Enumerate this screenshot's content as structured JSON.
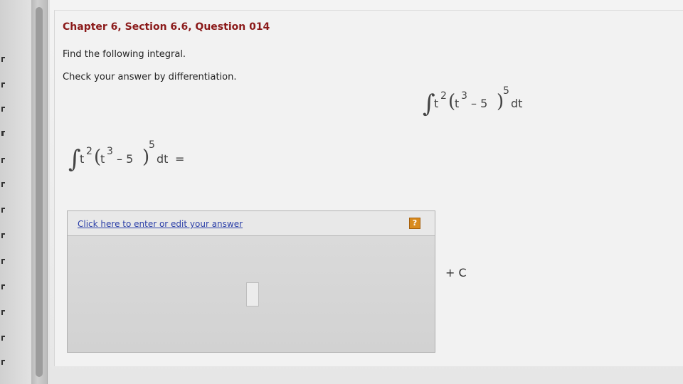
{
  "question": {
    "title": "Chapter 6, Section 6.6, Question 014",
    "instruction_1": "Find the following integral.",
    "instruction_2": "Check your answer by differentiation."
  },
  "integral": {
    "sign": "∫",
    "base": "t",
    "outer_exponent": "2",
    "open_paren": "(",
    "inner_base": "t",
    "inner_exponent": "3",
    "minus_five": "– 5",
    "close_paren": ")",
    "power": "5",
    "differential": "dt",
    "equals": "="
  },
  "answer": {
    "link_text": "Click here to enter or edit your answer",
    "help_label": "?",
    "constant": "+ C"
  },
  "icons": {
    "help": "help-icon",
    "cursor": "mouse-pointer-icon"
  },
  "colors": {
    "title": "#8b1a1a",
    "link": "#2b3fa8",
    "help": "#d98b1e"
  }
}
